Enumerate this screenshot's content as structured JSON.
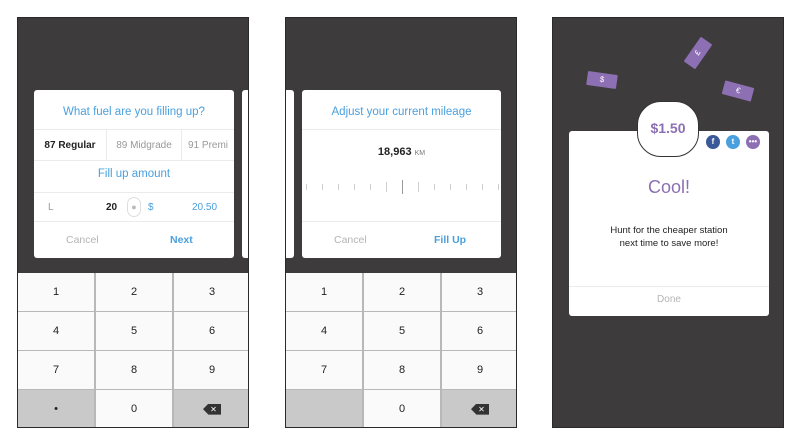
{
  "screen1": {
    "title": "What fuel are you filling up?",
    "fuel_options": [
      "87 Regular",
      "89 Midgrade",
      "91 Premi"
    ],
    "fill_label": "Fill up amount",
    "liters_label": "L",
    "liters_value": "20",
    "dollar_label": "$",
    "dollar_value": "20.50",
    "cancel": "Cancel",
    "next": "Next"
  },
  "screen2": {
    "title": "Adjust your current mileage",
    "mileage": "18,963",
    "unit": "KM",
    "cancel": "Cancel",
    "fill_up": "Fill Up"
  },
  "screen3": {
    "price": "$1.50",
    "heading": "Cool!",
    "message_line1": "Hunt for the cheaper station",
    "message_line2": "next time to save more!",
    "done": "Done",
    "bill_symbols": [
      "$",
      "£",
      "€"
    ],
    "share_icons": [
      "facebook-icon",
      "twitter-icon",
      "more-icon"
    ]
  },
  "keypad": {
    "keys": [
      "1",
      "2",
      "3",
      "4",
      "5",
      "6",
      "7",
      "8",
      "9",
      "•",
      "0"
    ]
  },
  "colors": {
    "accent_blue": "#4aa0de",
    "accent_purple": "#8d6fb3",
    "phone_bg": "#3d3b3c"
  }
}
